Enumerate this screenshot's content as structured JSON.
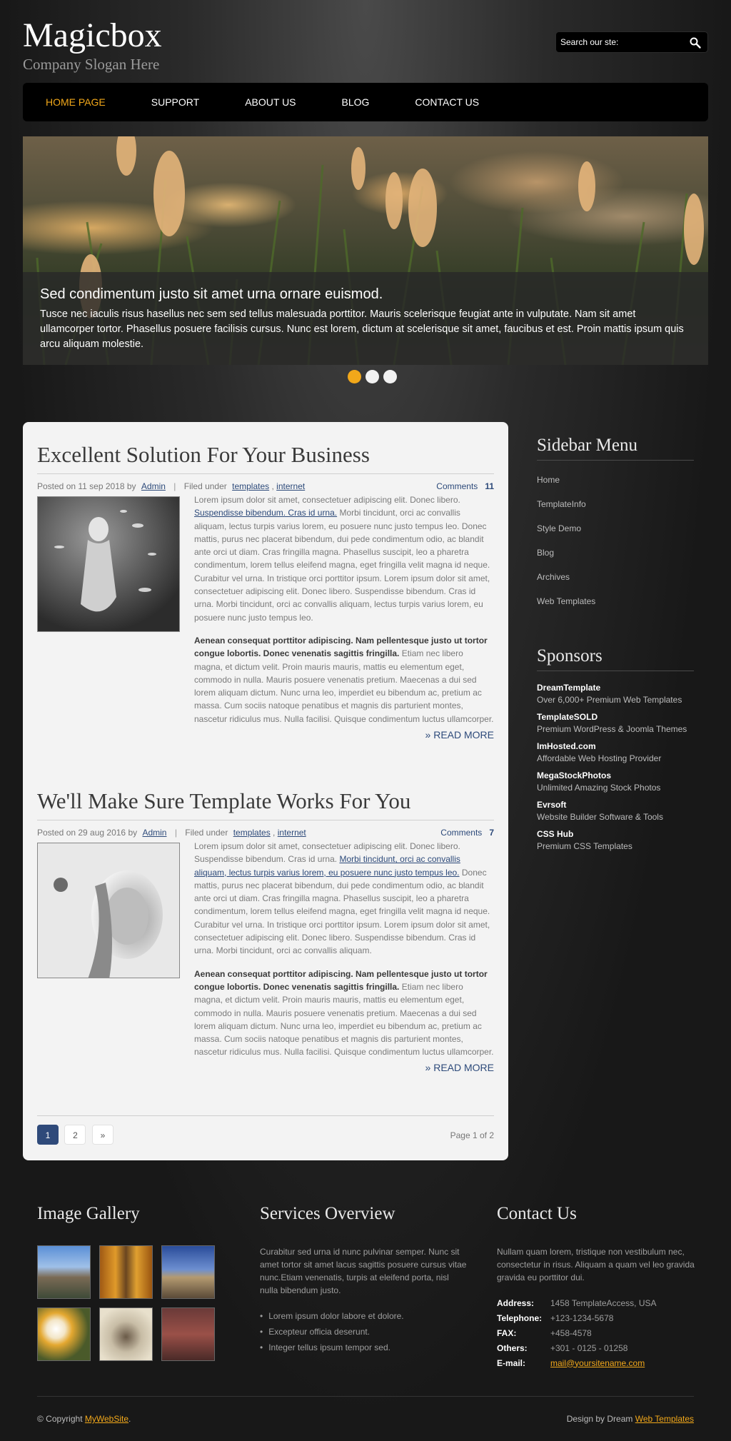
{
  "header": {
    "site_title": "Magicbox",
    "slogan": "Company Slogan Here",
    "search_placeholder": "Search our ste:"
  },
  "nav": {
    "items": [
      "HOME PAGE",
      "SUPPORT",
      "ABOUT US",
      "BLOG",
      "CONTACT US"
    ],
    "active": "HOME PAGE",
    "active_color": "#f2a81a"
  },
  "slider": {
    "heading": "Sed condimentum justo sit amet urna ornare euismod.",
    "text": "Tusce nec iaculis risus hasellus nec sem sed tellus malesuada porttitor. Mauris scelerisque feugiat ante in vulputate. Nam sit amet ullamcorper tortor. Phasellus posuere facilisis cursus. Nunc est lorem, dictum at scelerisque sit amet, faucibus et est. Proin mattis ipsum quis arcu aliquam molestie.",
    "slide_count": 3,
    "active_slide": 1
  },
  "posts": [
    {
      "title": "Excellent Solution For Your Business",
      "posted_prefix": "Posted on 11 sep 2018 by",
      "author": "Admin",
      "filed_label": "Filed under",
      "tag1": "templates",
      "tag2": "internet",
      "comments_label": "Comments",
      "comments_count": "11",
      "p1_a": "Lorem ipsum dolor sit amet, consectetuer adipiscing elit. Donec libero.",
      "p1_link": "Suspendisse bibendum. Cras id urna.",
      "p1_b": "Morbi tincidunt, orci ac convallis aliquam, lectus turpis varius lorem, eu posuere nunc justo tempus leo. Donec mattis, purus nec placerat bibendum, dui pede condimentum odio, ac blandit ante orci ut diam. Cras fringilla magna. Phasellus suscipit, leo a pharetra condimentum, lorem tellus eleifend magna, eget fringilla velit magna id neque. Curabitur vel urna. In tristique orci porttitor ipsum. Lorem ipsum dolor sit amet, consectetuer adipiscing elit. Donec libero. Suspendisse bibendum. Cras id urna. Morbi tincidunt, orci ac convallis aliquam, lectus turpis varius lorem, eu posuere nunc justo tempus leo.",
      "p2_bold": "Aenean consequat porttitor adipiscing. Nam pellentesque justo ut tortor congue lobortis. Donec venenatis sagittis fringilla.",
      "p2": "Etiam nec libero magna, et dictum velit. Proin mauris mauris, mattis eu elementum eget, commodo in nulla. Mauris posuere venenatis pretium. Maecenas a dui sed lorem aliquam dictum. Nunc urna leo, imperdiet eu bibendum ac, pretium ac massa. Cum sociis natoque penatibus et magnis dis parturient montes, nascetur ridiculus mus. Nulla facilisi. Quisque condimentum luctus ullamcorper.",
      "read_more": "» READ MORE"
    },
    {
      "title": "We'll Make Sure Template Works For You",
      "posted_prefix": "Posted on 29 aug 2016 by",
      "author": "Admin",
      "filed_label": "Filed under",
      "tag1": "templates",
      "tag2": "internet",
      "comments_label": "Comments",
      "comments_count": "7",
      "p1_a": "Lorem ipsum dolor sit amet, consectetuer adipiscing elit. Donec libero. Suspendisse bibendum. Cras id urna.",
      "p1_link": "Morbi tincidunt, orci ac convallis aliquam, lectus turpis varius lorem, eu posuere nunc justo tempus leo.",
      "p1_b": "Donec mattis, purus nec placerat bibendum, dui pede condimentum odio, ac blandit ante orci ut diam. Cras fringilla magna. Phasellus suscipit, leo a pharetra condimentum, lorem tellus eleifend magna, eget fringilla velit magna id neque. Curabitur vel urna. In tristique orci porttitor ipsum. Lorem ipsum dolor sit amet, consectetuer adipiscing elit. Donec libero. Suspendisse bibendum. Cras id urna. Morbi tincidunt, orci ac convallis aliquam.",
      "p2_bold": "Aenean consequat porttitor adipiscing. Nam pellentesque justo ut tortor congue lobortis. Donec venenatis sagittis fringilla.",
      "p2": "Etiam nec libero magna, et dictum velit. Proin mauris mauris, mattis eu elementum eget, commodo in nulla. Mauris posuere venenatis pretium. Maecenas a dui sed lorem aliquam dictum. Nunc urna leo, imperdiet eu bibendum ac, pretium ac massa. Cum sociis natoque penatibus et magnis dis parturient montes, nascetur ridiculus mus. Nulla facilisi. Quisque condimentum luctus ullamcorper.",
      "read_more": "» READ MORE"
    }
  ],
  "pager": {
    "pages": [
      "1",
      "2",
      "»"
    ],
    "current": "1",
    "info": "Page 1 of 2"
  },
  "sidebar": {
    "menu_title": "Sidebar Menu",
    "menu": [
      "Home",
      "TemplateInfo",
      "Style Demo",
      "Blog",
      "Archives",
      "Web Templates"
    ],
    "sponsors_title": "Sponsors",
    "sponsors": [
      {
        "name": "DreamTemplate",
        "desc": "Over 6,000+ Premium Web Templates"
      },
      {
        "name": "TemplateSOLD",
        "desc": "Premium WordPress & Joomla Themes"
      },
      {
        "name": "ImHosted.com",
        "desc": "Affordable Web Hosting Provider"
      },
      {
        "name": "MegaStockPhotos",
        "desc": "Unlimited Amazing Stock Photos"
      },
      {
        "name": "Evrsoft",
        "desc": "Website Builder Software & Tools"
      },
      {
        "name": "CSS Hub",
        "desc": "Premium CSS Templates"
      }
    ]
  },
  "footer": {
    "gallery_title": "Image Gallery",
    "services_title": "Services Overview",
    "services_text": "Curabitur sed urna id nunc pulvinar semper. Nunc sit amet tortor sit amet lacus sagittis posuere cursus vitae nunc.Etiam venenatis, turpis at eleifend porta, nisl nulla bibendum justo.",
    "services_list": [
      "Lorem ipsum dolor labore et dolore.",
      "Excepteur officia deserunt.",
      "Integer tellus ipsum tempor sed."
    ],
    "contact_title": "Contact Us",
    "contact_text": "Nullam quam lorem, tristique non vestibulum nec, consectetur in risus. Aliquam a quam vel leo gravida gravida eu porttitor dui.",
    "contact": {
      "address_label": "Address:",
      "address": "1458 TemplateAccess, USA",
      "tel_label": "Telephone:",
      "tel": "+123-1234-5678",
      "fax_label": "FAX:",
      "fax": "+458-4578",
      "others_label": "Others:",
      "others": "+301 - 0125 - 01258",
      "email_label": "E-mail:",
      "email": "mail@yoursitename.com"
    },
    "copyright_prefix": "© Copyright",
    "copyright_link": "MyWebSite",
    "design_prefix": "Design by Dream",
    "design_link": "Web Templates"
  }
}
